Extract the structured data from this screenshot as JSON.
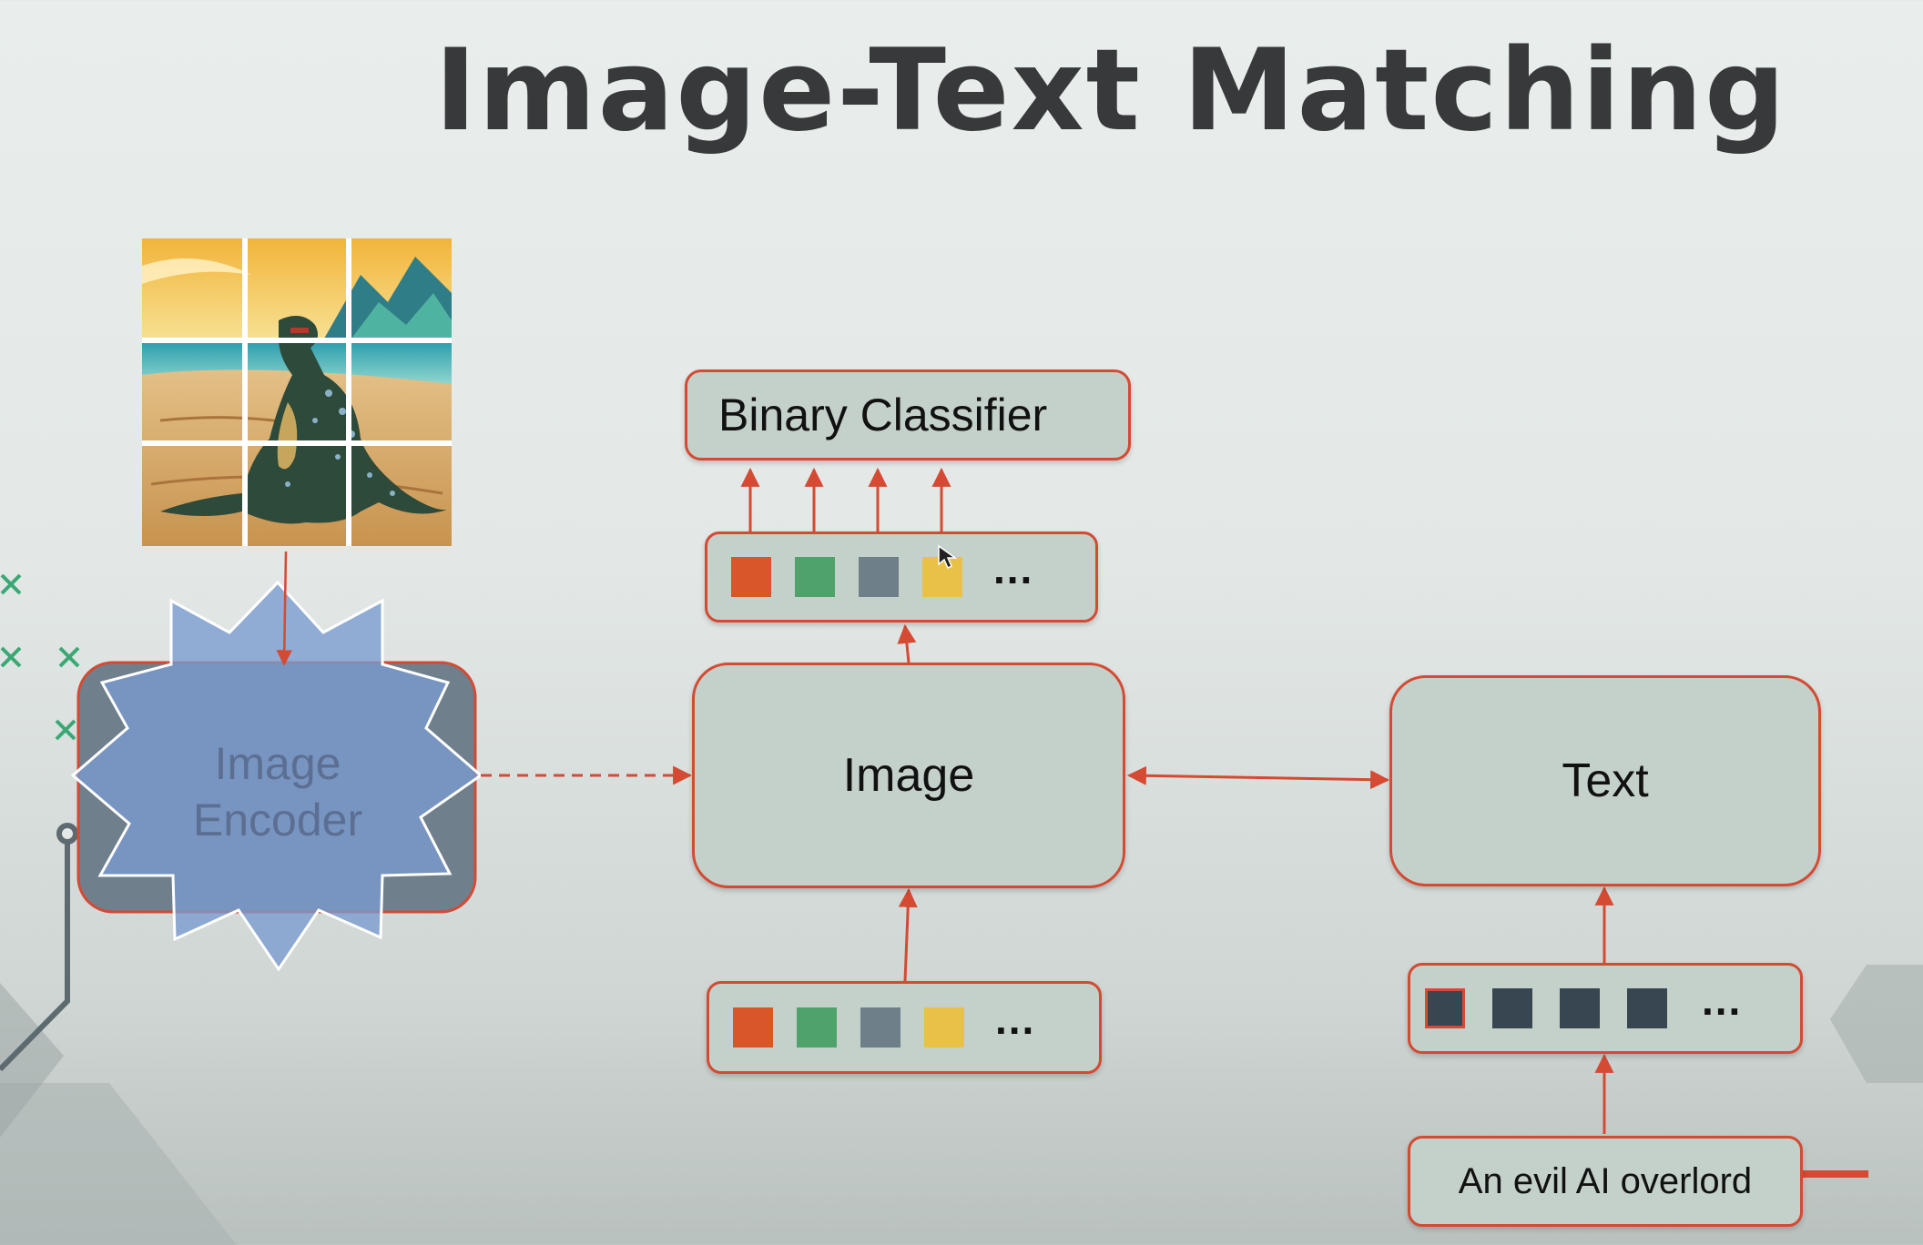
{
  "title": "Image-Text Matching",
  "diagram": {
    "nodes": {
      "binary_classifier": "Binary Classifier",
      "image": "Image",
      "text": "Text",
      "image_encoder": "Image\nEncoder",
      "caption": "An evil AI overlord"
    },
    "ellipsis": "...",
    "image_tokens": [
      "orange",
      "green",
      "gray",
      "yellow"
    ],
    "text_tokens": [
      "dark",
      "dark",
      "dark",
      "dark"
    ]
  },
  "colors": {
    "accent": "#d44a33",
    "box_fill": "#c4d1ca",
    "title": "#37393b",
    "encoder_fill": "#7a9bcf",
    "token_orange": "#d9552a",
    "token_green": "#4fa36a",
    "token_gray": "#6e7f8a",
    "token_yellow": "#e8c146",
    "token_dark": "#374650"
  },
  "icons": {
    "cross_marks": "x-mark-icon",
    "cursor": "mouse-cursor-icon"
  }
}
